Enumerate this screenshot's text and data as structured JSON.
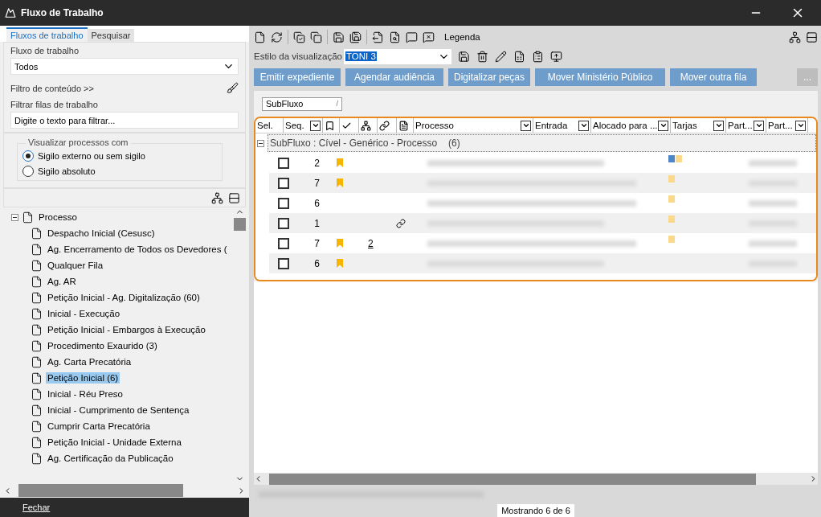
{
  "window": {
    "title": "Fluxo de Trabalho"
  },
  "left_tabs": [
    {
      "label": "Fluxos de trabalho",
      "selected": true
    },
    {
      "label": "Pesquisar",
      "selected": false
    }
  ],
  "workflow": {
    "label": "Fluxo de trabalho",
    "value": "Todos"
  },
  "content_filter": {
    "label": "Filtro de conteúdo >>"
  },
  "queue_filter": {
    "label": "Filtrar filas de trabalho",
    "placeholder": "Digite o texto para filtrar..."
  },
  "visibility": {
    "legend": "Visualizar processos com",
    "options": [
      {
        "label": "Sigilo externo ou sem sigilo",
        "selected": true
      },
      {
        "label": "Sigilo absoluto",
        "selected": false
      }
    ]
  },
  "tree": [
    {
      "label": "Processo",
      "expanded": true,
      "selected": false,
      "children": [
        {
          "label": "Despacho Inicial (Cesusc)",
          "selected": false
        },
        {
          "label": "Ag. Encerramento de Todos os Devedores (",
          "selected": false
        },
        {
          "label": "Qualquer Fila",
          "selected": false
        },
        {
          "label": "Ag. AR",
          "selected": false
        },
        {
          "label": "Petição Inicial - Ag. Digitalização (60)",
          "selected": false
        },
        {
          "label": "Inicial - Execução",
          "selected": false
        },
        {
          "label": "Petição Inicial - Embargos à Execução",
          "selected": false
        },
        {
          "label": "Procedimento Exaurido (3)",
          "selected": false
        },
        {
          "label": "Ag. Carta Precatória",
          "selected": false
        },
        {
          "label": "Petição Inicial (6)",
          "selected": true
        },
        {
          "label": "Inicial - Réu Preso",
          "selected": false
        },
        {
          "label": "Inicial - Cumprimento de Sentença",
          "selected": false
        },
        {
          "label": "Cumprir Carta Precatória",
          "selected": false
        },
        {
          "label": "Petição Inicial - Unidade Externa",
          "selected": false
        },
        {
          "label": "Ag. Certificação da Publicação",
          "selected": false
        }
      ]
    }
  ],
  "close_button": "Fechar",
  "toolbar": {
    "legend": "Legenda"
  },
  "view_style": {
    "label": "Estilo da visualização",
    "value": "TONI 3"
  },
  "actions": [
    "Emitir expediente",
    "Agendar audiência",
    "Digitalizar peças",
    "Mover Ministério Público",
    "Mover outra fila"
  ],
  "more_button": "...",
  "group_by": {
    "label": "SubFluxo",
    "sort": "/"
  },
  "columns": [
    {
      "kind": "text",
      "label": "Sel.",
      "filter": false
    },
    {
      "kind": "text",
      "label": "Seq.",
      "filter": true
    },
    {
      "kind": "bookmark"
    },
    {
      "kind": "check"
    },
    {
      "kind": "tree"
    },
    {
      "kind": "link"
    },
    {
      "kind": "document"
    },
    {
      "kind": "text",
      "label": "Processo",
      "filter": true
    },
    {
      "kind": "text",
      "label": "Entrada",
      "filter": true
    },
    {
      "kind": "text",
      "label": "Alocado para ...",
      "filter": true
    },
    {
      "kind": "text",
      "label": "Tarjas",
      "filter": true
    },
    {
      "kind": "text",
      "label": "Part...",
      "filter": true
    },
    {
      "kind": "text",
      "label": "Part...",
      "filter": true
    }
  ],
  "group": {
    "label": "SubFluxo : Cível - Genérico - Processo",
    "count": "(6)",
    "expanded": true
  },
  "rows": [
    {
      "checked": false,
      "seq": "2",
      "bookmarked": true,
      "tags": [
        {
          "color": "#4f86c6"
        },
        {
          "color": "#fbd98a"
        }
      ]
    },
    {
      "checked": false,
      "seq": "7",
      "bookmarked": true,
      "tags": [
        {
          "color": "#fbd98a"
        }
      ]
    },
    {
      "checked": false,
      "seq": "6",
      "bookmarked": false,
      "tags": [
        {
          "color": "#fbd98a"
        }
      ]
    },
    {
      "checked": false,
      "seq": "1",
      "bookmarked": false,
      "linked": true,
      "tags": [
        {
          "color": "#fbd98a"
        }
      ]
    },
    {
      "checked": false,
      "seq": "7",
      "bookmarked": true,
      "count": "2",
      "tags": [
        {
          "color": "#fbd98a"
        }
      ]
    },
    {
      "checked": false,
      "seq": "6",
      "bookmarked": true,
      "tags": []
    }
  ],
  "status": "Mostrando 6 de 6"
}
